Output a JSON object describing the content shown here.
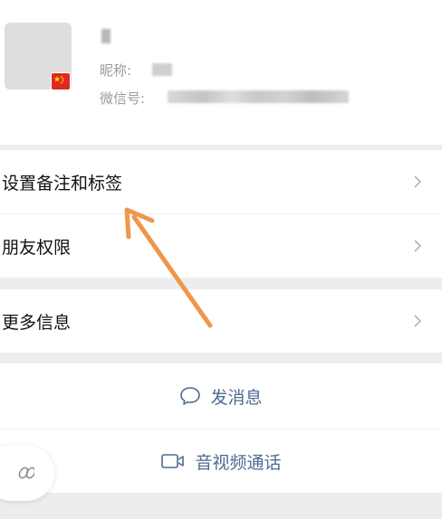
{
  "profile": {
    "nickname_label": "昵称:",
    "wechat_id_label": "微信号:"
  },
  "menu": [
    {
      "label": "设置备注和标签"
    },
    {
      "label": "朋友权限"
    },
    {
      "label": "更多信息"
    }
  ],
  "actions": {
    "message": "发消息",
    "call": "音视频通话"
  },
  "colors": {
    "accent": "#4f6a93",
    "arrow": "#f0964a",
    "flag": "#de2a1e"
  }
}
